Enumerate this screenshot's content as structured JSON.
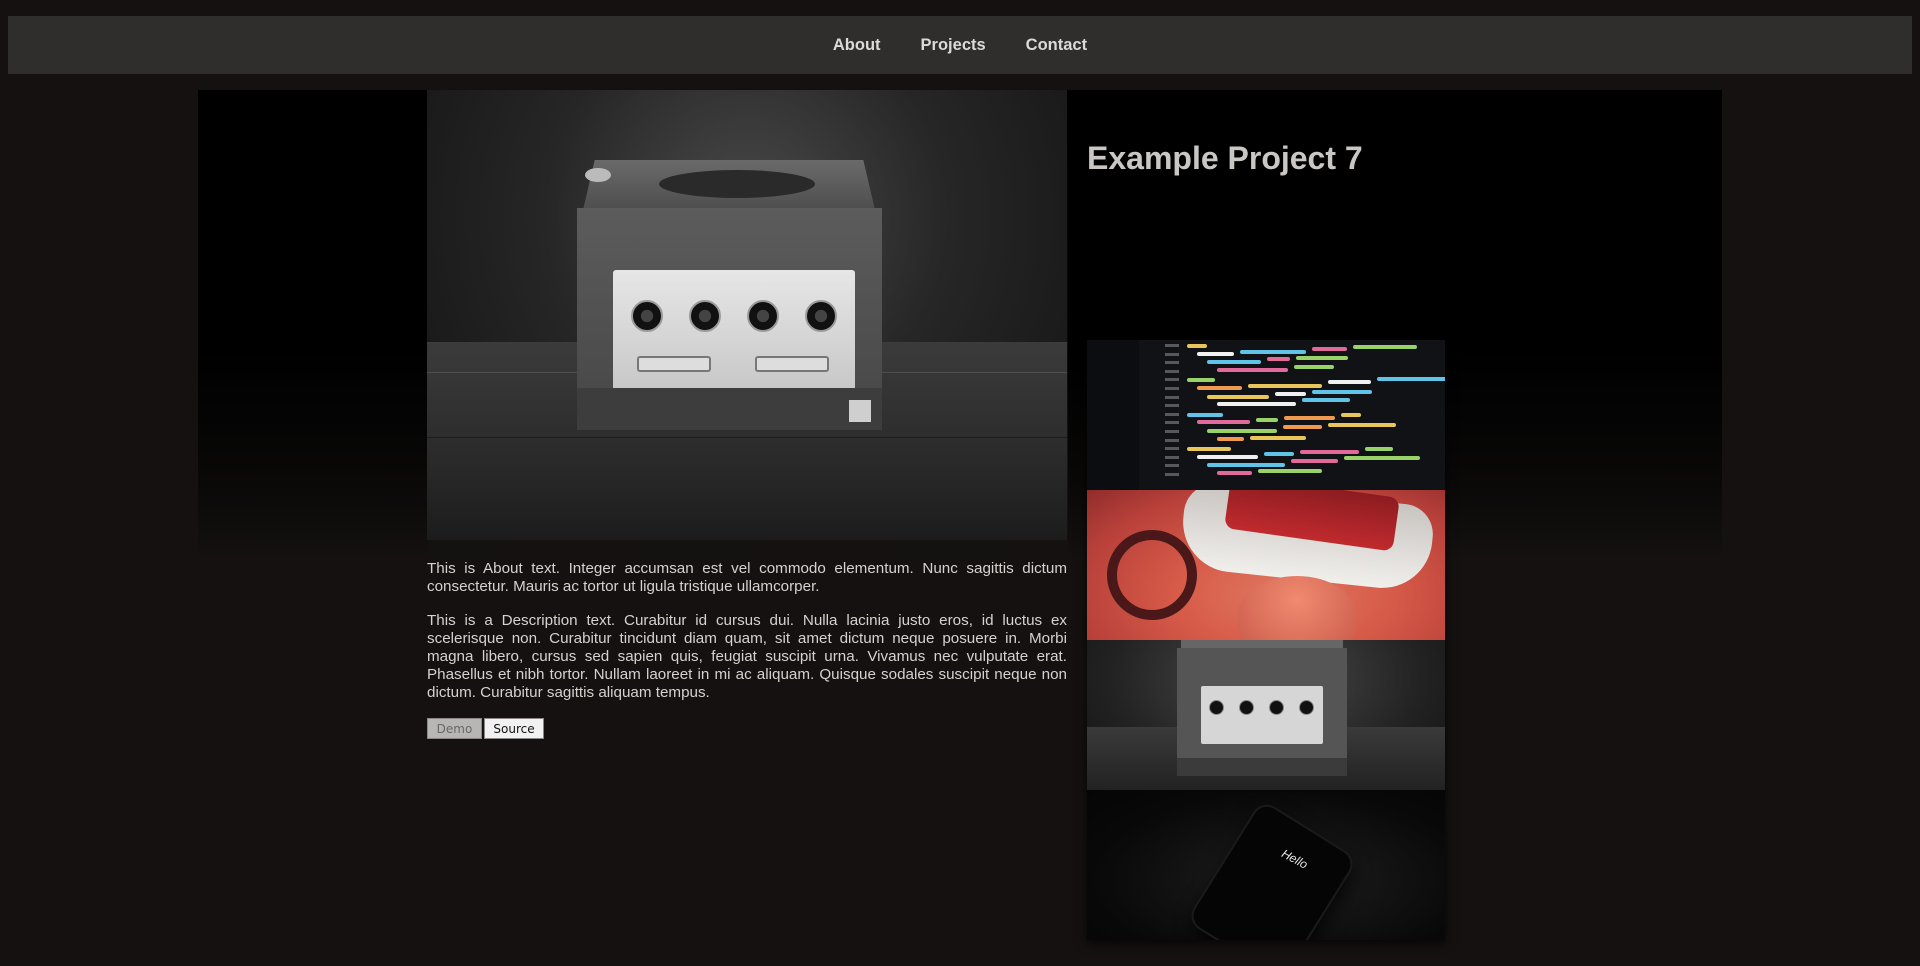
{
  "nav": {
    "items": [
      {
        "label": "About"
      },
      {
        "label": "Projects"
      },
      {
        "label": "Contact"
      }
    ]
  },
  "project": {
    "title": "Example Project 7",
    "about_text": "This is About text. Integer accumsan est vel commodo elementum. Nunc sagittis dictum consectetur. Mauris ac tortor ut ligula tristique ullamcorper.",
    "description_text": "This is a Description text. Curabitur id cursus dui. Nulla lacinia justo eros, id luctus ex scelerisque non. Curabitur tincidunt diam quam, sit amet dictum neque posuere in. Morbi magna libero, cursus sed sapien quis, feugiat suscipit urna. Vivamus nec vulputate erat. Phasellus et nibh tortor. Nullam laoreet in mi ac aliquam. Quisque sodales suscipit neque non dictum. Curabitur sagittis aliquam tempus.",
    "buttons": {
      "demo_label": "Demo",
      "source_label": "Source"
    }
  },
  "main_image": {
    "subject": "game console"
  },
  "gallery": {
    "thumbnails": [
      {
        "subject": "code on screen"
      },
      {
        "subject": "person wearing VR headset"
      },
      {
        "subject": "game console"
      },
      {
        "subject": "phone",
        "screen_text": "Hello"
      }
    ]
  },
  "colors": {
    "background": "#141110",
    "navbar": "#2f2e2d",
    "text": "#d6d2ce",
    "title": "#c9c6c3"
  }
}
